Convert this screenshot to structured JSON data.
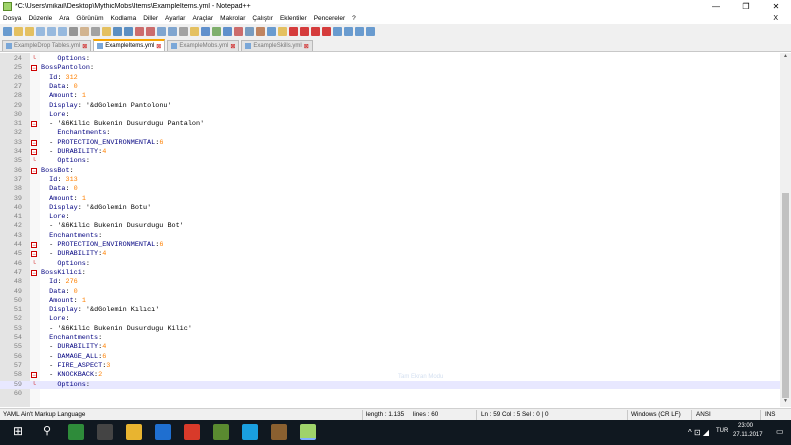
{
  "window": {
    "title": "*C:\\Users\\mikail\\Desktop\\MythicMobs\\Items\\ExampleItems.yml - Notepad++",
    "minimize": "—",
    "maximize": "❐",
    "close": "✕"
  },
  "menu": [
    "Dosya",
    "Düzenle",
    "Ara",
    "Görünüm",
    "Kodlama",
    "Diller",
    "Ayarlar",
    "Araçlar",
    "Makrolar",
    "Çalıştır",
    "Eklentiler",
    "Pencereler",
    "?"
  ],
  "menu_close": "X",
  "tabs": [
    {
      "label": "ExampleDrop Tables.yml",
      "active": false
    },
    {
      "label": "ExampleItems.yml",
      "active": true
    },
    {
      "label": "ExampleMobs.yml",
      "active": false
    },
    {
      "label": "ExampleSkills.yml",
      "active": false
    }
  ],
  "lines": [
    {
      "n": "24",
      "t": "    Options:",
      "cur": false
    },
    {
      "n": "25",
      "t": "BossPantolon:",
      "cur": false
    },
    {
      "n": "26",
      "t": "  Id: 312",
      "cur": false
    },
    {
      "n": "27",
      "t": "  Data: 0",
      "cur": false
    },
    {
      "n": "28",
      "t": "  Amount: 1",
      "cur": false
    },
    {
      "n": "29",
      "t": "  Display: '&dGolemin Pantolonu'",
      "cur": false
    },
    {
      "n": "30",
      "t": "  Lore:",
      "cur": false
    },
    {
      "n": "31",
      "t": "  - '&6Kilic Bukenin Dusurdugu Pantalon'",
      "cur": false
    },
    {
      "n": "32",
      "t": "    Enchantments:",
      "cur": false
    },
    {
      "n": "33",
      "t": "  - PROTECTION_ENVIRONMENTAL:6",
      "cur": false
    },
    {
      "n": "34",
      "t": "  - DURABILITY:4",
      "cur": false
    },
    {
      "n": "35",
      "t": "    Options:",
      "cur": false
    },
    {
      "n": "36",
      "t": "BossBot:",
      "cur": false
    },
    {
      "n": "37",
      "t": "  Id: 313",
      "cur": false
    },
    {
      "n": "38",
      "t": "  Data: 0",
      "cur": false
    },
    {
      "n": "39",
      "t": "  Amount: 1",
      "cur": false
    },
    {
      "n": "40",
      "t": "  Display: '&dGolemin Botu'",
      "cur": false
    },
    {
      "n": "41",
      "t": "  Lore:",
      "cur": false
    },
    {
      "n": "42",
      "t": "  - '&6Kilic Bukenin Dusurdugu Bot'",
      "cur": false
    },
    {
      "n": "43",
      "t": "  Enchantments:",
      "cur": false
    },
    {
      "n": "44",
      "t": "  - PROTECTION_ENVIRONMENTAL:6",
      "cur": false
    },
    {
      "n": "45",
      "t": "  - DURABILITY:4",
      "cur": false
    },
    {
      "n": "46",
      "t": "    Options:",
      "cur": false
    },
    {
      "n": "47",
      "t": "BossKilici:",
      "cur": false
    },
    {
      "n": "48",
      "t": "  Id: 276",
      "cur": false
    },
    {
      "n": "49",
      "t": "  Data: 0",
      "cur": false
    },
    {
      "n": "50",
      "t": "  Amount: 1",
      "cur": false
    },
    {
      "n": "51",
      "t": "  Display: '&dGolemin Kılıcı'",
      "cur": false
    },
    {
      "n": "52",
      "t": "  Lore:",
      "cur": false
    },
    {
      "n": "53",
      "t": "  - '&6Kilic Bukenin Dusurdugu Kilic'",
      "cur": false
    },
    {
      "n": "54",
      "t": "  Enchantments:",
      "cur": false
    },
    {
      "n": "55",
      "t": "  - DURABILITY:4",
      "cur": false
    },
    {
      "n": "56",
      "t": "  - DAMAGE_ALL:6",
      "cur": false
    },
    {
      "n": "57",
      "t": "  - FIRE_ASPECT:3",
      "cur": false
    },
    {
      "n": "58",
      "t": "  - KNOCKBACK:2",
      "cur": false
    },
    {
      "n": "59",
      "t": "    Options:",
      "cur": true
    },
    {
      "n": "60",
      "t": "",
      "cur": false
    }
  ],
  "watermark": "Tam Ekran Modu",
  "status": {
    "language": "YAML Ain't Markup Language",
    "length": "length : 1.135",
    "lines": "lines : 60",
    "position": "Ln : 59   Col : 5   Sel : 0 | 0",
    "eol": "Windows (CR LF)",
    "encoding": "ANSI",
    "mode": "INS"
  },
  "taskbar": {
    "time": "23:00",
    "date": "27.11.2017",
    "lang": "TUR",
    "icons": [
      "windows-start-icon",
      "search-icon",
      "app-c-icon",
      "pen-app-icon",
      "file-explorer-icon",
      "edge-icon",
      "chrome-icon",
      "minecraft-icon",
      "skype-icon",
      "chest-app-icon",
      "notepadpp-icon"
    ]
  },
  "colors": {
    "key": "#000080",
    "number": "#ff8000",
    "current_line": "#e8e8ff",
    "taskbar": "#101820"
  }
}
